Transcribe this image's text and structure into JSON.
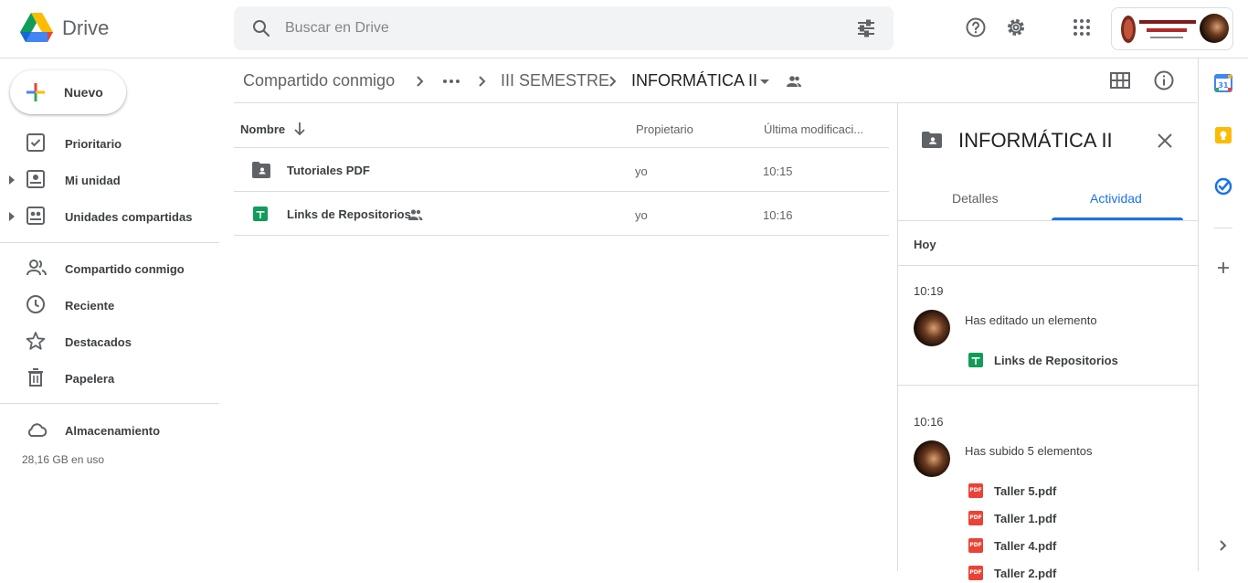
{
  "header": {
    "app_name": "Drive",
    "search_placeholder": "Buscar en Drive",
    "org_badge_text": "INSTITUTO SUPERIOR TECNOLÓGICO",
    "org_badge_sub": "Juan Montalvo"
  },
  "sidebar": {
    "new_label": "Nuevo",
    "items": [
      {
        "label": "Prioritario",
        "icon": "priority-icon"
      },
      {
        "label": "Mi unidad",
        "icon": "my-drive-icon"
      },
      {
        "label": "Unidades compartidas",
        "icon": "shared-drives-icon"
      },
      {
        "label": "Compartido conmigo",
        "icon": "shared-with-me-icon"
      },
      {
        "label": "Reciente",
        "icon": "clock-icon"
      },
      {
        "label": "Destacados",
        "icon": "star-icon"
      },
      {
        "label": "Papelera",
        "icon": "trash-icon"
      },
      {
        "label": "Almacenamiento",
        "icon": "cloud-icon"
      }
    ],
    "storage_used": "28,16 GB en uso"
  },
  "breadcrumb": {
    "items": [
      "Compartido conmigo",
      "III SEMESTRE",
      "INFORMÁTICA II"
    ]
  },
  "files": {
    "columns": [
      "Nombre",
      "Propietario",
      "Última modificaci..."
    ],
    "rows": [
      {
        "name": "Tutoriales PDF",
        "owner": "yo",
        "modified": "10:15",
        "type": "shared-folder"
      },
      {
        "name": "Links de Repositorios",
        "owner": "yo",
        "modified": "10:16",
        "type": "sheets",
        "shared": true
      }
    ]
  },
  "panel": {
    "title": "INFORMÁTICA II",
    "tabs": [
      "Detalles",
      "Actividad"
    ],
    "active_tab": "Actividad",
    "day_header": "Hoy",
    "activities": [
      {
        "time": "10:19",
        "text": "Has editado un elemento",
        "files": [
          "Links de Repositorios"
        ]
      },
      {
        "time": "10:16",
        "text": "Has subido 5 elementos",
        "files": [
          "Taller 5.pdf",
          "Taller 1.pdf",
          "Taller 4.pdf",
          "Taller 2.pdf"
        ]
      }
    ]
  },
  "colors": {
    "accent": "#1a73e8",
    "sheets_green": "#0f9d58",
    "pdf_red": "#ea4335"
  }
}
